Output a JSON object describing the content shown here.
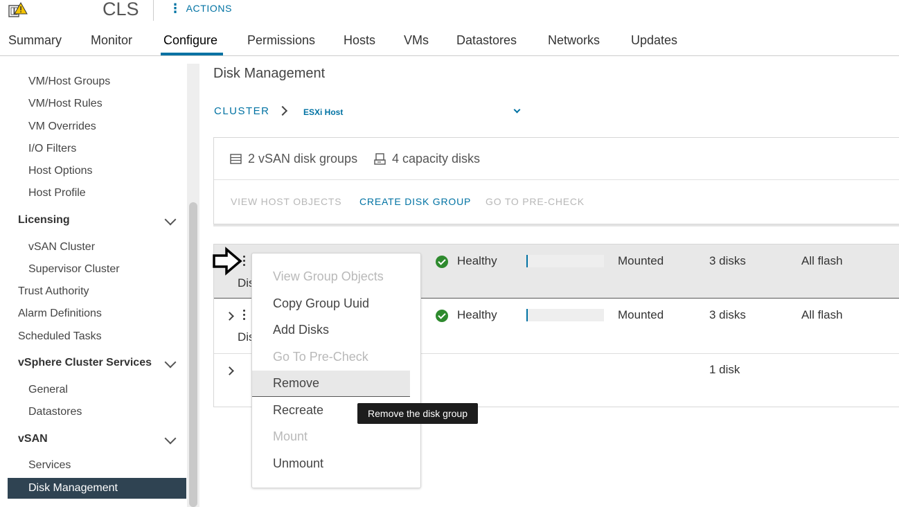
{
  "header": {
    "object_title": "CLS",
    "actions_label": "ACTIONS",
    "icon": "cluster-warning-icon"
  },
  "tabs": [
    {
      "label": "Summary"
    },
    {
      "label": "Monitor"
    },
    {
      "label": "Configure",
      "active": true
    },
    {
      "label": "Permissions"
    },
    {
      "label": "Hosts"
    },
    {
      "label": "VMs"
    },
    {
      "label": "Datastores"
    },
    {
      "label": "Networks"
    },
    {
      "label": "Updates"
    }
  ],
  "sidebar": {
    "items_top": [
      "VM/Host Groups",
      "VM/Host Rules",
      "VM Overrides",
      "I/O Filters",
      "Host Options",
      "Host Profile"
    ],
    "licensing": {
      "label": "Licensing",
      "items": [
        "vSAN Cluster",
        "Supervisor Cluster"
      ]
    },
    "misc": [
      "Trust Authority",
      "Alarm Definitions",
      "Scheduled Tasks"
    ],
    "vcls": {
      "label": "vSphere Cluster Services",
      "items": [
        "General",
        "Datastores"
      ]
    },
    "vsan": {
      "label": "vSAN",
      "items": [
        "Services",
        "Disk Management"
      ],
      "selected": "Disk Management"
    }
  },
  "main": {
    "title": "Disk Management",
    "breadcrumb": {
      "cluster": "CLUSTER",
      "host": "ESXi Host"
    },
    "summary": {
      "disk_groups": "2 vSAN disk groups",
      "capacity_disks": "4 capacity disks"
    },
    "actions": {
      "view_host_objects": "VIEW HOST OBJECTS",
      "create_disk_group": "CREATE DISK GROUP",
      "go_to_precheck": "GO TO PRE-CHECK"
    },
    "rows": [
      {
        "name_prefix": "Dis",
        "health": "Healthy",
        "state": "Mounted",
        "disks": "3 disks",
        "type": "All flash"
      },
      {
        "name_prefix": "Dis",
        "health": "Healthy",
        "state": "Mounted",
        "disks": "3 disks",
        "type": "All flash"
      },
      {
        "disks": "1 disk"
      }
    ]
  },
  "context_menu": {
    "items": [
      {
        "label": "View Group Objects",
        "enabled": false
      },
      {
        "label": "Copy Group Uuid",
        "enabled": true
      },
      {
        "label": "Add Disks",
        "enabled": true
      },
      {
        "label": "Go To Pre-Check",
        "enabled": false
      },
      {
        "label": "Remove",
        "enabled": true,
        "highlighted": true
      },
      {
        "label": "Recreate",
        "enabled": true
      },
      {
        "label": "Mount",
        "enabled": false
      },
      {
        "label": "Unmount",
        "enabled": true
      }
    ],
    "tooltip": "Remove the disk group"
  },
  "colors": {
    "accent": "#0072a3",
    "selected_bg": "#2f4352",
    "healthy": "#2e8a2e"
  }
}
